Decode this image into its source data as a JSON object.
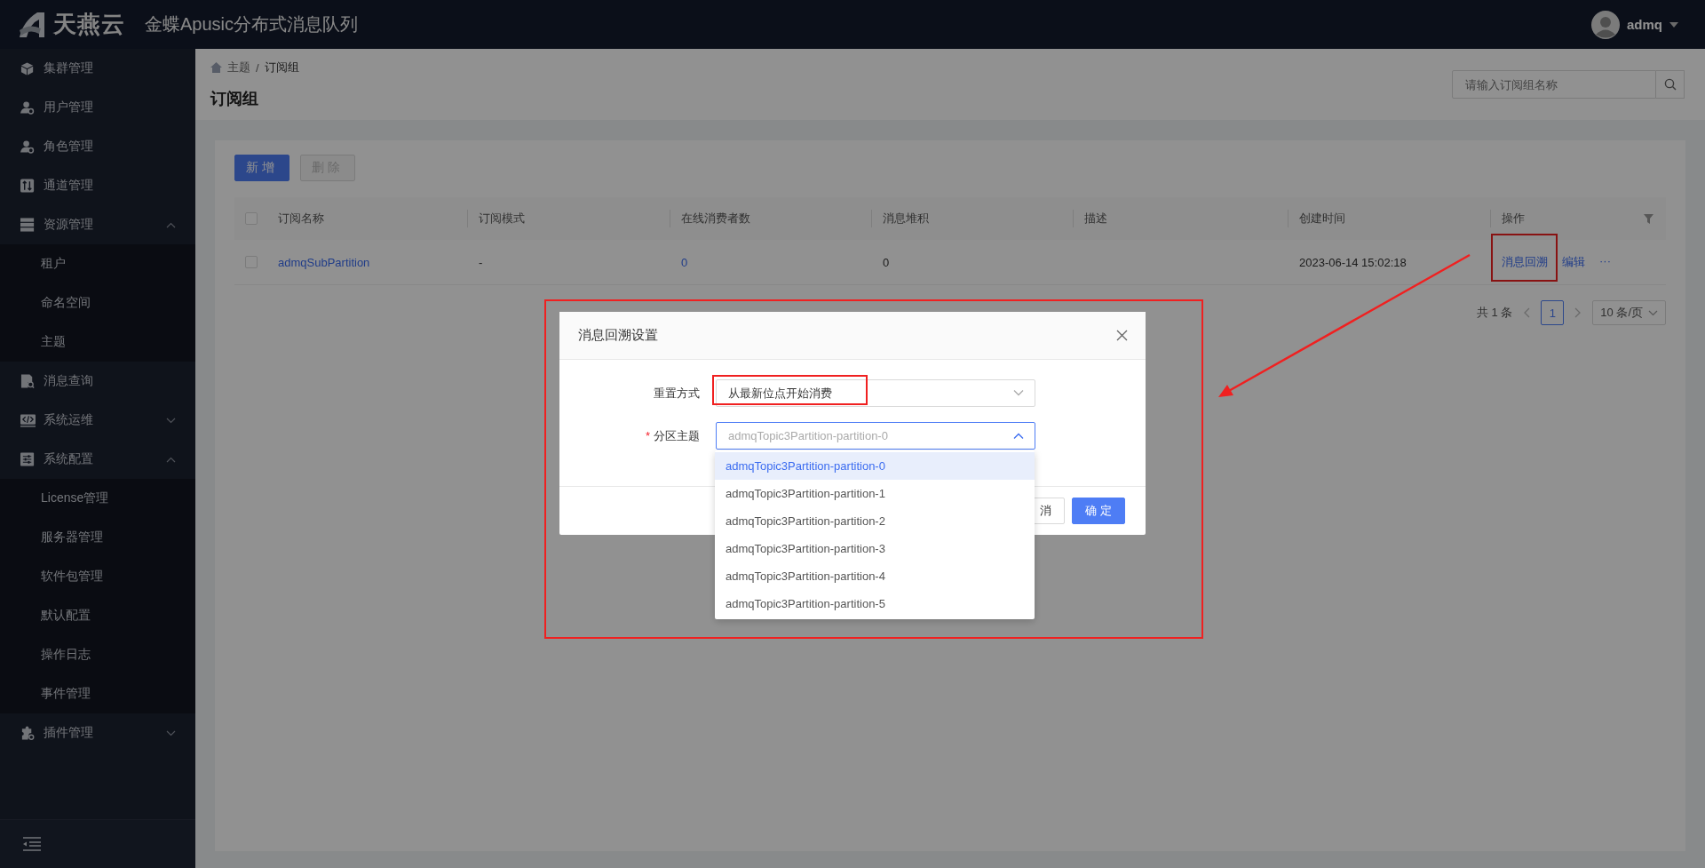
{
  "header": {
    "logo_text": "天燕云",
    "app_title": "金蝶Apusic分布式消息队列",
    "user": {
      "name": "admq"
    }
  },
  "sidebar": {
    "items": [
      {
        "label": "集群管理"
      },
      {
        "label": "用户管理"
      },
      {
        "label": "角色管理"
      },
      {
        "label": "通道管理"
      },
      {
        "label": "资源管理",
        "expanded": true,
        "children": [
          {
            "label": "租户"
          },
          {
            "label": "命名空间"
          },
          {
            "label": "主题"
          }
        ]
      },
      {
        "label": "消息查询"
      },
      {
        "label": "系统运维",
        "expanded": false
      },
      {
        "label": "系统配置",
        "expanded": true,
        "children": [
          {
            "label": "License管理"
          },
          {
            "label": "服务器管理"
          },
          {
            "label": "软件包管理"
          },
          {
            "label": "默认配置"
          },
          {
            "label": "操作日志"
          },
          {
            "label": "事件管理"
          }
        ]
      },
      {
        "label": "插件管理",
        "expanded": false
      }
    ]
  },
  "breadcrumb": {
    "separator": "/",
    "items": [
      "主题",
      "订阅组"
    ]
  },
  "page_title": "订阅组",
  "search": {
    "placeholder": "请输入订阅组名称"
  },
  "toolbar": [
    {
      "label": "新增",
      "disabled": false
    },
    {
      "label": "删除",
      "disabled": true
    }
  ],
  "table": {
    "header_checked": false,
    "columns": [
      "订阅名称",
      "订阅模式",
      "在线消费者数",
      "消息堆积",
      "描述",
      "创建时间",
      "操作"
    ],
    "rows": [
      {
        "checked": false,
        "name": "admqSubPartition",
        "mode": "-",
        "online_consumers": "0",
        "backlog": "0",
        "created": "2023-06-14 15:02:18",
        "actions": [
          {
            "label": "消息回溯",
            "highlighted": true
          },
          {
            "label": "编辑",
            "highlighted": false
          },
          {
            "label": "···",
            "highlighted": false
          }
        ]
      }
    ]
  },
  "pagination": {
    "total": "共 1 条",
    "pages": [
      {
        "label": "1",
        "selected": true
      }
    ],
    "page_size": "10 条/页"
  },
  "dialog": {
    "title": "消息回溯设置",
    "highlighted": true,
    "required_mark": "*",
    "fields": [
      {
        "label": "重置方式",
        "value": "从最新位点开始消费",
        "required": false,
        "expanded": false,
        "highlighted": true
      },
      {
        "label": "分区主题",
        "placeholder": "admqTopic3Partition-partition-0",
        "required": true,
        "expanded": true,
        "highlighted": false
      }
    ],
    "options": [
      {
        "label": "admqTopic3Partition-partition-0",
        "selected": true
      },
      {
        "label": "admqTopic3Partition-partition-1",
        "selected": false
      },
      {
        "label": "admqTopic3Partition-partition-2",
        "selected": false
      },
      {
        "label": "admqTopic3Partition-partition-3",
        "selected": false
      },
      {
        "label": "admqTopic3Partition-partition-4",
        "selected": false
      },
      {
        "label": "admqTopic3Partition-partition-5",
        "selected": false
      }
    ],
    "buttons": [
      {
        "label": "消",
        "kind": "default"
      },
      {
        "label": "确定",
        "kind": "primary"
      }
    ]
  },
  "annotations": [
    {
      "kind": "arrow"
    }
  ]
}
